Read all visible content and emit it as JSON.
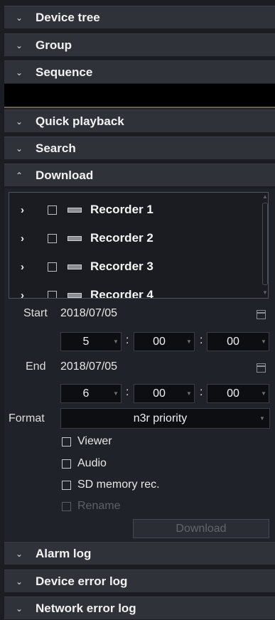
{
  "panels": {
    "device_tree": "Device tree",
    "group": "Group",
    "sequence": "Sequence",
    "quick_playback": "Quick playback",
    "search": "Search",
    "download": "Download",
    "alarm_log": "Alarm log",
    "device_error_log": "Device error log",
    "network_error_log": "Network error log"
  },
  "recorders": [
    "Recorder 1",
    "Recorder 2",
    "Recorder 3",
    "Recorder 4"
  ],
  "start": {
    "label": "Start",
    "date": "2018/07/05",
    "hour": "5",
    "minute": "00",
    "second": "00"
  },
  "end": {
    "label": "End",
    "date": "2018/07/05",
    "hour": "6",
    "minute": "00",
    "second": "00"
  },
  "colon": ":",
  "format": {
    "label": "Format",
    "value": "n3r priority"
  },
  "options": {
    "viewer": "Viewer",
    "audio": "Audio",
    "sd_memory": "SD memory rec.",
    "rename": "Rename"
  },
  "download_button": "Download",
  "icons": {
    "collapsed": "chevron-down-icon",
    "expanded": "chevron-up-icon",
    "tree_expand": "chevron-right-icon",
    "recorder": "recorder-icon",
    "calendar": "calendar-icon"
  }
}
